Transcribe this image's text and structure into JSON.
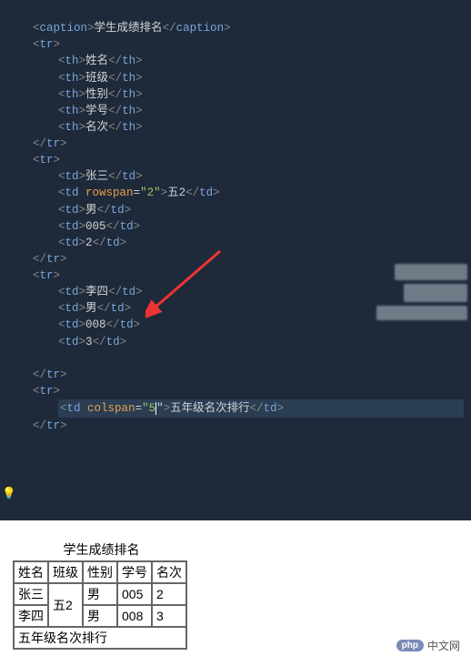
{
  "code": {
    "caption_tag": "caption",
    "caption_text": "学生成绩排名",
    "tr_tag": "tr",
    "th_tag": "th",
    "td_tag": "td",
    "headers": [
      "姓名",
      "班级",
      "性别",
      "学号",
      "名次"
    ],
    "row1": {
      "name": "张三",
      "rowspan_attr": "rowspan",
      "rowspan_val": "\"2\"",
      "class_text": "五2",
      "gender": "男",
      "sid": "005",
      "rank": "2"
    },
    "row2": {
      "name": "李四",
      "gender": "男",
      "sid": "008",
      "rank": "3"
    },
    "footer": {
      "colspan_attr": "colspan",
      "colspan_val_partial": "\"5",
      "footer_text": "五年级名次排行"
    },
    "lt": "<",
    "gt": ">",
    "lt_close": "</"
  },
  "preview": {
    "caption": "学生成绩排名",
    "headers": {
      "c1": "姓名",
      "c2": "班级",
      "c3": "性别",
      "c4": "学号",
      "c5": "名次"
    },
    "r1": {
      "name": "张三",
      "class": "五2",
      "gender": "男",
      "sid": "005",
      "rank": "2"
    },
    "r2": {
      "name": "李四",
      "gender": "男",
      "sid": "008",
      "rank": "3"
    },
    "footer": "五年级名次排行"
  },
  "watermark": {
    "badge": "php",
    "text": "中文网"
  },
  "bulb": "💡"
}
